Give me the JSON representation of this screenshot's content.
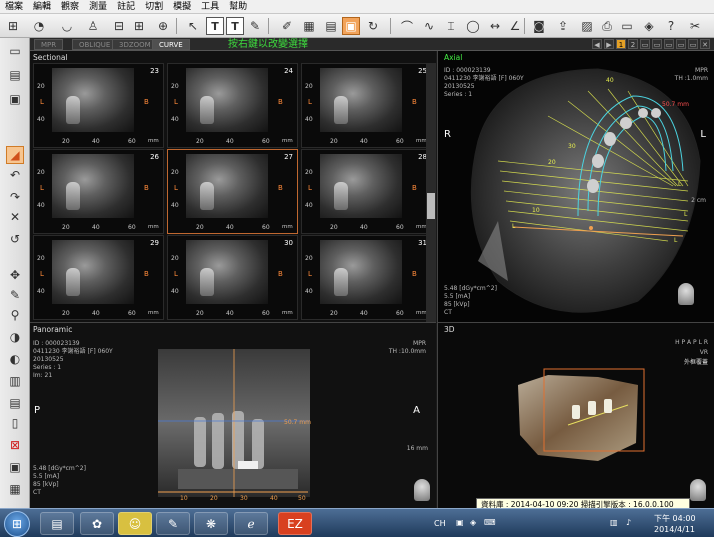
{
  "menu": [
    "檔案",
    "編輯",
    "觀察",
    "測量",
    "註記",
    "切割",
    "模擬",
    "工具",
    "幫助"
  ],
  "tabs": [
    "MPR",
    "OBLIQUE",
    "3DZOOM",
    "CURVE"
  ],
  "active_tab": "CURVE",
  "hint": "按右鍵以改變選擇",
  "tab_controls": [
    "1",
    "2"
  ],
  "sectional": {
    "title": "Sectional",
    "cells": [
      {
        "num": "23"
      },
      {
        "num": "24"
      },
      {
        "num": "25"
      },
      {
        "num": "26"
      },
      {
        "num": "27"
      },
      {
        "num": "28"
      },
      {
        "num": "29"
      },
      {
        "num": "30"
      },
      {
        "num": "31"
      }
    ],
    "left_label": "L",
    "right_label": "B",
    "v_ticks": [
      "20",
      "40"
    ],
    "h_ticks": [
      "20",
      "40",
      "60"
    ],
    "unit": "mm"
  },
  "axial": {
    "title": "Axial",
    "id_line": "ID : 000023139",
    "patient": "0411230 李謝裕語 [F] 060Y",
    "date": "20130525",
    "series": "Series : 1",
    "mode": "MPR",
    "thickness": "TH :1.0mm",
    "measure": "50.7 mm",
    "label_R": "R",
    "label_L": "L",
    "arch_labels": [
      "40",
      "30",
      "20",
      "10",
      "L",
      "L",
      "L",
      "L"
    ],
    "scale": "2 cm",
    "dose": "5.48  [dGy*cm^2]",
    "ma": "5.5  [mA]",
    "kv": "85 [kVp]",
    "modality": "CT"
  },
  "panoramic": {
    "title": "Panoramic",
    "id_line": "ID : 000023139",
    "patient": "0411230 李謝裕語 [F] 060Y",
    "date": "20130525",
    "series": "Series : 1",
    "im": "Im: 21",
    "mode": "MPR",
    "thickness": "TH :10.0mm",
    "label_P": "P",
    "label_A": "A",
    "measure": "50.7 mm",
    "scale_text": "16 mm",
    "x_ticks": [
      "10",
      "20",
      "30",
      "40",
      "50"
    ],
    "dose": "5.48  [dGy*cm^2]",
    "ma": "5.5  [mA]",
    "kv": "85 [kVp]",
    "modality": "CT"
  },
  "three_d": {
    "title": "3D",
    "orient": "H P A P L R",
    "vr": "VR",
    "preset": "外框覆蓋"
  },
  "tooltip": "資料庫 : 2014-04-10 09:20  掃描引擎版本 : 16.0.0.100",
  "taskbar": {
    "lang": "CH",
    "time": "下午 04:00",
    "date": "2014/4/11"
  }
}
